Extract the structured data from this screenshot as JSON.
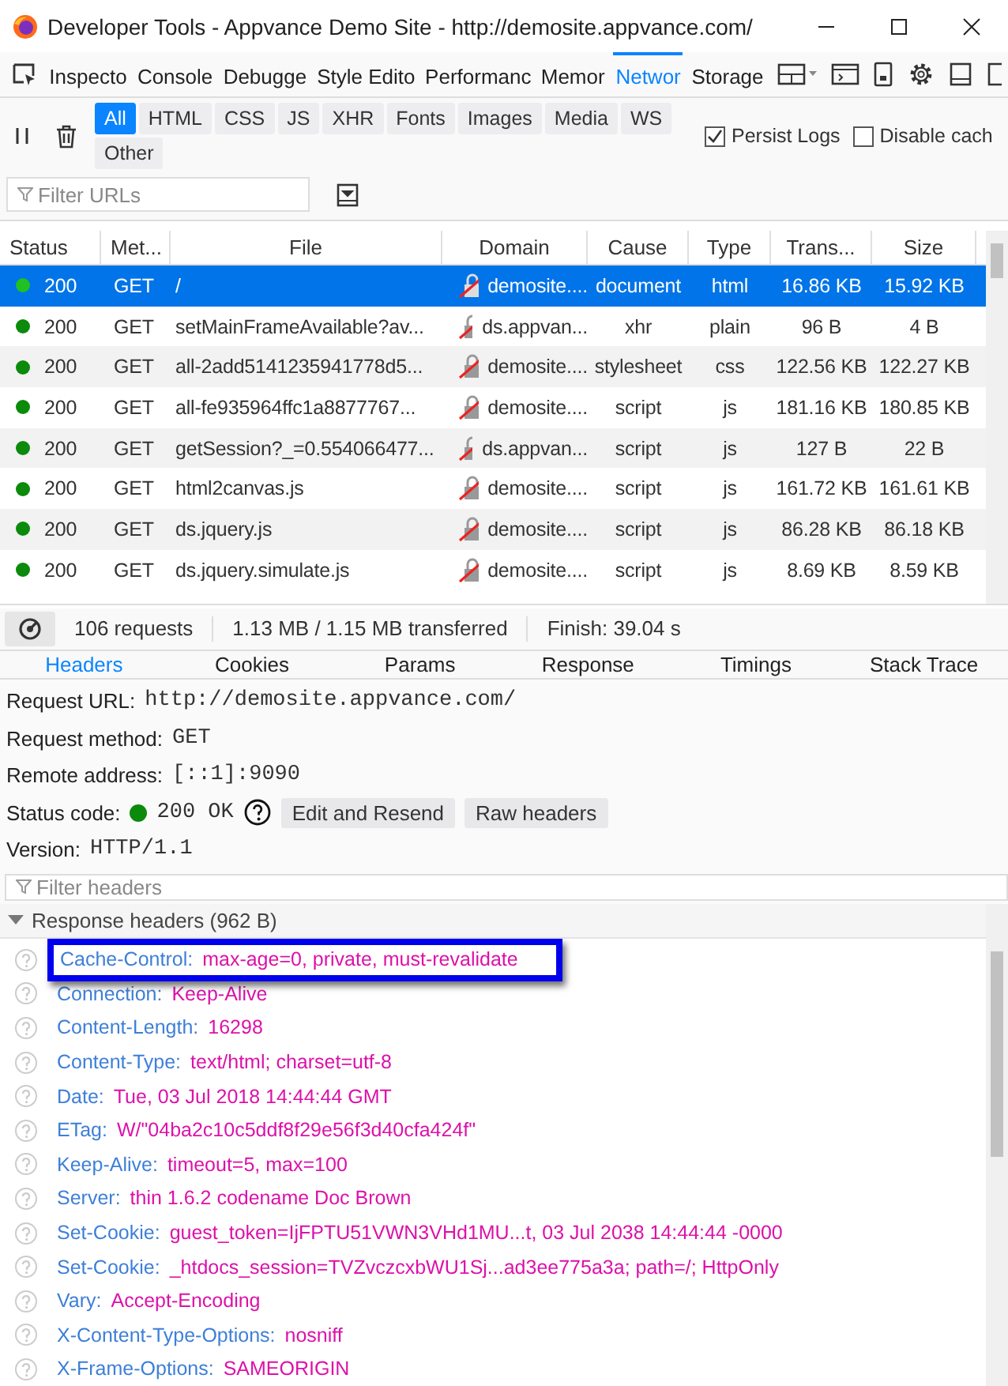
{
  "window": {
    "title": "Developer Tools - Appvance Demo Site - http://demosite.appvance.com/"
  },
  "tools": [
    {
      "label": "Inspecto",
      "selected": false
    },
    {
      "label": "Console",
      "selected": false
    },
    {
      "label": "Debugge",
      "selected": false
    },
    {
      "label": "Style Edito",
      "selected": false
    },
    {
      "label": "Performanc",
      "selected": false
    },
    {
      "label": "Memor",
      "selected": false
    },
    {
      "label": "Networ",
      "selected": true
    },
    {
      "label": "Storage",
      "selected": false
    }
  ],
  "type_filters": [
    {
      "label": "All",
      "selected": true
    },
    {
      "label": "HTML",
      "selected": false
    },
    {
      "label": "CSS",
      "selected": false
    },
    {
      "label": "JS",
      "selected": false
    },
    {
      "label": "XHR",
      "selected": false
    },
    {
      "label": "Fonts",
      "selected": false
    },
    {
      "label": "Images",
      "selected": false
    },
    {
      "label": "Media",
      "selected": false
    },
    {
      "label": "WS",
      "selected": false
    },
    {
      "label": "Other",
      "selected": false
    }
  ],
  "options": [
    {
      "label": "Persist Logs",
      "checked": true
    },
    {
      "label": "Disable cach",
      "checked": false
    }
  ],
  "url_filter": {
    "placeholder": "Filter URLs"
  },
  "table": {
    "columns": [
      "Status",
      "Met...",
      "File",
      "Domain",
      "Cause",
      "Type",
      "Trans...",
      "Size"
    ],
    "rows": [
      {
        "status": "200",
        "color": "#22c022",
        "method": "GET",
        "file": "/",
        "domain": "demosite....",
        "cause": "document",
        "type": "html",
        "transferred": "16.86 KB",
        "size": "15.92 KB",
        "selected": true
      },
      {
        "status": "200",
        "color": "#0b8a0b",
        "method": "GET",
        "file": "setMainFrameAvailable?av...",
        "domain": "ds.appvan...",
        "cause": "xhr",
        "type": "plain",
        "transferred": "96 B",
        "size": "4 B",
        "selected": false
      },
      {
        "status": "200",
        "color": "#0b8a0b",
        "method": "GET",
        "file": "all-2add5141235941778d5...",
        "domain": "demosite....",
        "cause": "stylesheet",
        "type": "css",
        "transferred": "122.56 KB",
        "size": "122.27 KB",
        "selected": false
      },
      {
        "status": "200",
        "color": "#0b8a0b",
        "method": "GET",
        "file": "all-fe935964ffc1a8877767...",
        "domain": "demosite....",
        "cause": "script",
        "type": "js",
        "transferred": "181.16 KB",
        "size": "180.85 KB",
        "selected": false
      },
      {
        "status": "200",
        "color": "#0b8a0b",
        "method": "GET",
        "file": "getSession?_=0.554066477...",
        "domain": "ds.appvan...",
        "cause": "script",
        "type": "js",
        "transferred": "127 B",
        "size": "22 B",
        "selected": false
      },
      {
        "status": "200",
        "color": "#0b8a0b",
        "method": "GET",
        "file": "html2canvas.js",
        "domain": "demosite....",
        "cause": "script",
        "type": "js",
        "transferred": "161.72 KB",
        "size": "161.61 KB",
        "selected": false
      },
      {
        "status": "200",
        "color": "#0b8a0b",
        "method": "GET",
        "file": "ds.jquery.js",
        "domain": "demosite....",
        "cause": "script",
        "type": "js",
        "transferred": "86.28 KB",
        "size": "86.18 KB",
        "selected": false
      },
      {
        "status": "200",
        "color": "#0b8a0b",
        "method": "GET",
        "file": "ds.jquery.simulate.js",
        "domain": "demosite....",
        "cause": "script",
        "type": "js",
        "transferred": "8.69 KB",
        "size": "8.59 KB",
        "selected": false
      }
    ]
  },
  "summary": [
    "106 requests",
    "1.13 MB / 1.15 MB transferred",
    "Finish: 39.04 s"
  ],
  "detail_tabs": [
    {
      "label": "Headers",
      "selected": true
    },
    {
      "label": "Cookies",
      "selected": false
    },
    {
      "label": "Params",
      "selected": false
    },
    {
      "label": "Response",
      "selected": false
    },
    {
      "label": "Timings",
      "selected": false
    },
    {
      "label": "Stack Trace",
      "selected": false
    }
  ],
  "request": [
    {
      "label": "Request URL:",
      "value": "http://demosite.appvance.com/"
    },
    {
      "label": "Request method:",
      "value": "GET"
    },
    {
      "label": "Remote address:",
      "value": "[::1]:9090"
    }
  ],
  "status_code": {
    "label": "Status code:",
    "value": "200 OK",
    "color": "#0b8a0b",
    "buttons": [
      "Edit and Resend",
      "Raw headers"
    ]
  },
  "version": {
    "label": "Version:",
    "value": "HTTP/1.1"
  },
  "header_filter": {
    "placeholder": "Filter headers"
  },
  "response_headers": {
    "title": "Response headers (962 B)",
    "expanded": true,
    "items": [
      {
        "name": "Cache-Control:",
        "value": "max-age=0, private, must-revalidate",
        "highlighted": true
      },
      {
        "name": "Connection:",
        "value": "Keep-Alive",
        "highlighted": false
      },
      {
        "name": "Content-Length:",
        "value": "16298",
        "highlighted": false
      },
      {
        "name": "Content-Type:",
        "value": "text/html; charset=utf-8",
        "highlighted": false
      },
      {
        "name": "Date:",
        "value": "Tue, 03 Jul 2018 14:44:44 GMT",
        "highlighted": false
      },
      {
        "name": "ETag:",
        "value": "W/\"04ba2c10c5ddf8f29e56f3d40cfa424f\"",
        "highlighted": false
      },
      {
        "name": "Keep-Alive:",
        "value": "timeout=5, max=100",
        "highlighted": false
      },
      {
        "name": "Server:",
        "value": "thin 1.6.2 codename Doc Brown",
        "highlighted": false
      },
      {
        "name": "Set-Cookie:",
        "value": "guest_token=IjFPTU51VWN3VHd1MU...t, 03 Jul 2038 14:44:44 -0000",
        "highlighted": false
      },
      {
        "name": "Set-Cookie:",
        "value": "_htdocs_session=TVZvczcxbWU1Sj...ad3ee775a3a; path=/; HttpOnly",
        "highlighted": false
      },
      {
        "name": "Vary:",
        "value": "Accept-Encoding",
        "highlighted": false
      },
      {
        "name": "X-Content-Type-Options:",
        "value": "nosniff",
        "highlighted": false
      },
      {
        "name": "X-Frame-Options:",
        "value": "SAMEORIGIN",
        "highlighted": false
      }
    ]
  }
}
